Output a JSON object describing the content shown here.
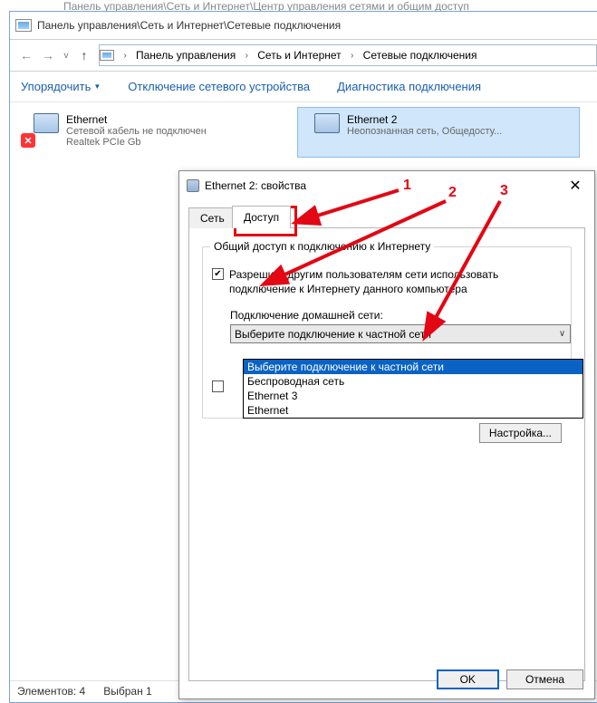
{
  "parent_title": "Панель управления\\Сеть и Интернет\\Центр управления сетями и общим доступ",
  "explorer": {
    "title": "Панель управления\\Сеть и Интернет\\Сетевые подключения",
    "breadcrumb": [
      "Панель управления",
      "Сеть и Интернет",
      "Сетевые подключения"
    ],
    "commands": {
      "organize": "Упорядочить",
      "disable": "Отключение сетевого устройства",
      "diagnose": "Диагностика подключения"
    },
    "connections": [
      {
        "name": "Ethernet",
        "line2": "Сетевой кабель не подключен",
        "line3": "Realtek PCIe Gb",
        "red_x": true,
        "selected": false
      },
      {
        "name": "Ethernet 2",
        "line2": "Неопознанная сеть, Общедосту...",
        "line3": "",
        "red_x": false,
        "selected": true
      }
    ],
    "status": {
      "elements_label": "Элементов:",
      "elements": "4",
      "selected_label": "Выбран 1"
    }
  },
  "dialog": {
    "title": "Ethernet 2: свойства",
    "close": "✕",
    "tabs": {
      "network": "Сеть",
      "sharing": "Доступ"
    },
    "group_label": "Общий доступ к подключению к Интернету",
    "checkbox1_checked": "✔",
    "checkbox1_text": "Разрешить другим пользователям сети использовать подключение к Интернету данного компьютера",
    "home_net_label": "Подключение домашней сети:",
    "select_value": "Выберите подключение к частной сети",
    "dropdown_options": [
      "Выберите подключение к частной сети",
      "Беспроводная сеть",
      "Ethernet 3",
      "Ethernet"
    ],
    "checkbox2_checked": "",
    "settings_button": "Настройка...",
    "buttons": {
      "ok": "OK",
      "cancel": "Отмена"
    }
  },
  "annotations": {
    "n1": "1",
    "n2": "2",
    "n3": "3"
  }
}
